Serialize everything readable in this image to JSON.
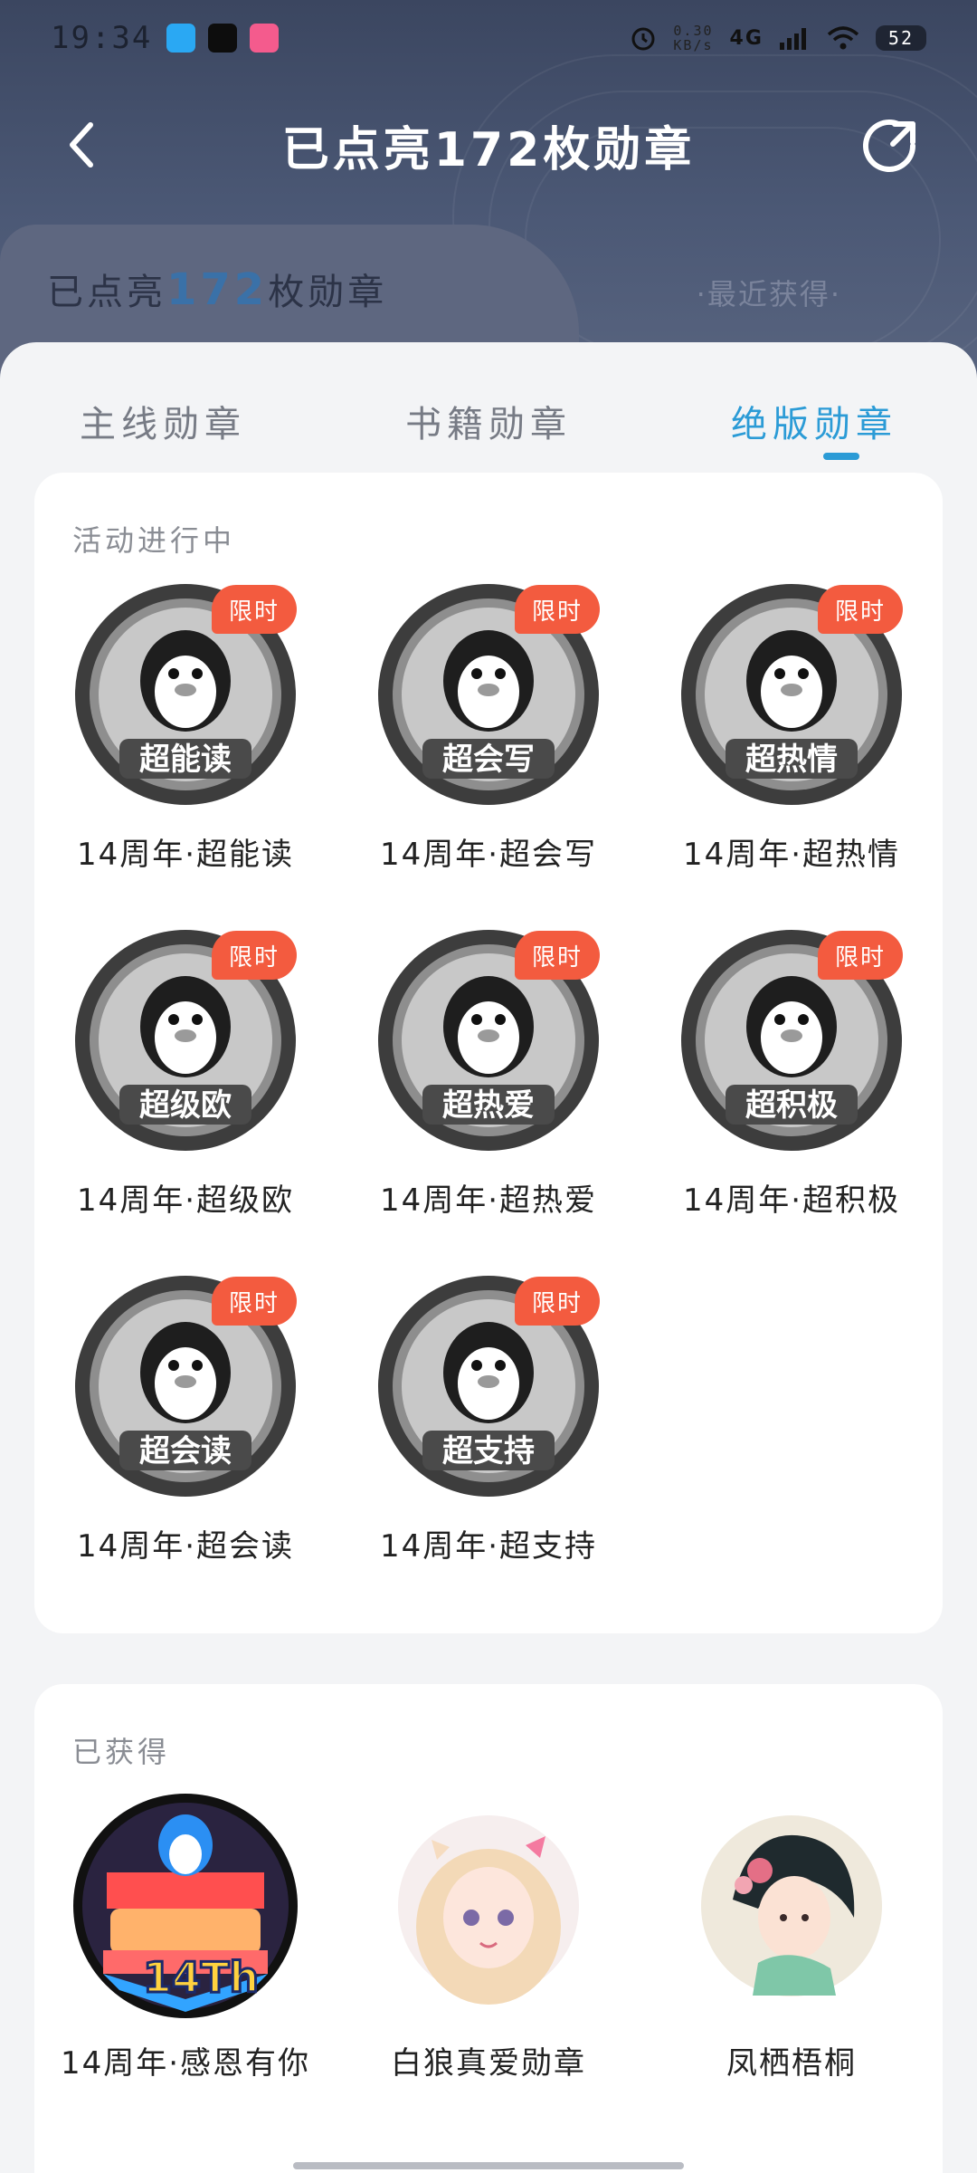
{
  "status_bar": {
    "time": "19:34",
    "speed_value": "0.30",
    "speed_unit": "KB/s",
    "network": "4G",
    "battery": "52"
  },
  "header": {
    "title": "已点亮172枚勋章",
    "count_prefix": "已点亮",
    "count_number": "172",
    "count_suffix": "枚勋章",
    "recent_link": "·最近获得·"
  },
  "tabs": [
    {
      "label": "主线勋章",
      "active": false
    },
    {
      "label": "书籍勋章",
      "active": false
    },
    {
      "label": "绝版勋章",
      "active": true
    }
  ],
  "ongoing_section": {
    "title": "活动进行中",
    "limit_tag": "限时",
    "badges": [
      {
        "name": "14周年·超能读",
        "art": "超能读"
      },
      {
        "name": "14周年·超会写",
        "art": "超会写"
      },
      {
        "name": "14周年·超热情",
        "art": "超热情"
      },
      {
        "name": "14周年·超级欧",
        "art": "超级欧"
      },
      {
        "name": "14周年·超热爱",
        "art": "超热爱"
      },
      {
        "name": "14周年·超积极",
        "art": "超积极"
      },
      {
        "name": "14周年·超会读",
        "art": "超会读"
      },
      {
        "name": "14周年·超支持",
        "art": "超支持"
      }
    ]
  },
  "acquired_section": {
    "title": "已获得",
    "badges": [
      {
        "name": "14周年·感恩有你"
      },
      {
        "name": "白狼真爱勋章"
      },
      {
        "name": "凤栖梧桐"
      }
    ]
  },
  "colors": {
    "accent": "#2b9bd6",
    "limit_tag": "#f35b3f",
    "header_bg": "#3b4660"
  }
}
